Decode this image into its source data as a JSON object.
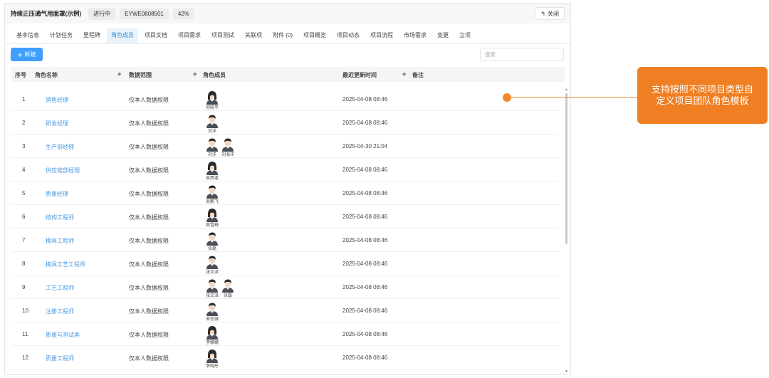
{
  "header": {
    "project_name": "持续正压通气用面罩(示例)",
    "status": "进行中",
    "code": "EYWE0808501",
    "progress": "42%",
    "close_label": "关闭"
  },
  "tabs": [
    {
      "label": "基本信息"
    },
    {
      "label": "计划任务"
    },
    {
      "label": "里程碑"
    },
    {
      "label": "角色成员"
    },
    {
      "label": "项目文档"
    },
    {
      "label": "项目需求"
    },
    {
      "label": "项目测试"
    },
    {
      "label": "关联项"
    },
    {
      "label": "附件 (0)"
    },
    {
      "label": "项目概览"
    },
    {
      "label": "项目动态"
    },
    {
      "label": "项目流程"
    },
    {
      "label": "市场需求"
    },
    {
      "label": "变更"
    },
    {
      "label": "立项"
    }
  ],
  "active_tab": "角色成员",
  "toolbar": {
    "new_label": "新建",
    "search_placeholder": "搜索"
  },
  "table": {
    "headers": {
      "idx": "序号",
      "name": "角色名称",
      "scope": "数据范围",
      "members": "角色成员",
      "time": "最近更新时间",
      "note": "备注"
    },
    "rows": [
      {
        "idx": "1",
        "name": "销售经理",
        "scope": "仅本人数据权限",
        "members": [
          {
            "name": "何晓平",
            "gender": "f"
          }
        ],
        "time": "2025-04-08 08:46"
      },
      {
        "idx": "2",
        "name": "研发经理",
        "scope": "仅本人数据权限",
        "members": [
          {
            "name": "刘洋",
            "gender": "m"
          }
        ],
        "time": "2025-04-08 08:46"
      },
      {
        "idx": "3",
        "name": "生产部经理",
        "scope": "仅本人数据权限",
        "members": [
          {
            "name": "刘洋",
            "gender": "m"
          },
          {
            "name": "刘海洋",
            "gender": "m"
          }
        ],
        "time": "2025-04-30 21:04"
      },
      {
        "idx": "4",
        "name": "供应链部经理",
        "scope": "仅本人数据权限",
        "members": [
          {
            "name": "吴西逢",
            "gender": "f"
          }
        ],
        "time": "2025-04-08 08:46"
      },
      {
        "idx": "5",
        "name": "质量经理",
        "scope": "仅本人数据权限",
        "members": [
          {
            "name": "吴鹏飞",
            "gender": "m"
          }
        ],
        "time": "2025-04-08 08:46"
      },
      {
        "idx": "6",
        "name": "结构工程师",
        "scope": "仅本人数据权限",
        "members": [
          {
            "name": "周雪梅",
            "gender": "f"
          }
        ],
        "time": "2025-04-08 08:46"
      },
      {
        "idx": "7",
        "name": "模具工程师",
        "scope": "仅本人数据权限",
        "members": [
          {
            "name": "张磊",
            "gender": "m"
          }
        ],
        "time": "2025-04-08 08:46"
      },
      {
        "idx": "8",
        "name": "模具工艺工程师",
        "scope": "仅本人数据权限",
        "members": [
          {
            "name": "张文派",
            "gender": "m"
          }
        ],
        "time": "2025-04-08 08:46"
      },
      {
        "idx": "9",
        "name": "工艺工程师",
        "scope": "仅本人数据权限",
        "members": [
          {
            "name": "张文派",
            "gender": "m"
          },
          {
            "name": "张磊",
            "gender": "m"
          }
        ],
        "time": "2025-04-08 08:46"
      },
      {
        "idx": "10",
        "name": "注册工程师",
        "scope": "仅本人数据权限",
        "members": [
          {
            "name": "宋志强",
            "gender": "m"
          }
        ],
        "time": "2025-04-08 08:46"
      },
      {
        "idx": "11",
        "name": "质量与测试类",
        "scope": "仅本人数据权限",
        "members": [
          {
            "name": "李娜娜",
            "gender": "f"
          }
        ],
        "time": "2025-04-08 08:46"
      },
      {
        "idx": "12",
        "name": "质量工程师",
        "scope": "仅本人数据权限",
        "members": [
          {
            "name": "李晓彤",
            "gender": "f"
          }
        ],
        "time": "2025-04-08 08:46"
      }
    ]
  },
  "callout": {
    "text": "支持按照不同项目类型自定义项目团队角色模板"
  },
  "colors": {
    "accent": "#409eff",
    "link": "#4d9be0",
    "callout": "#ef7f22"
  }
}
